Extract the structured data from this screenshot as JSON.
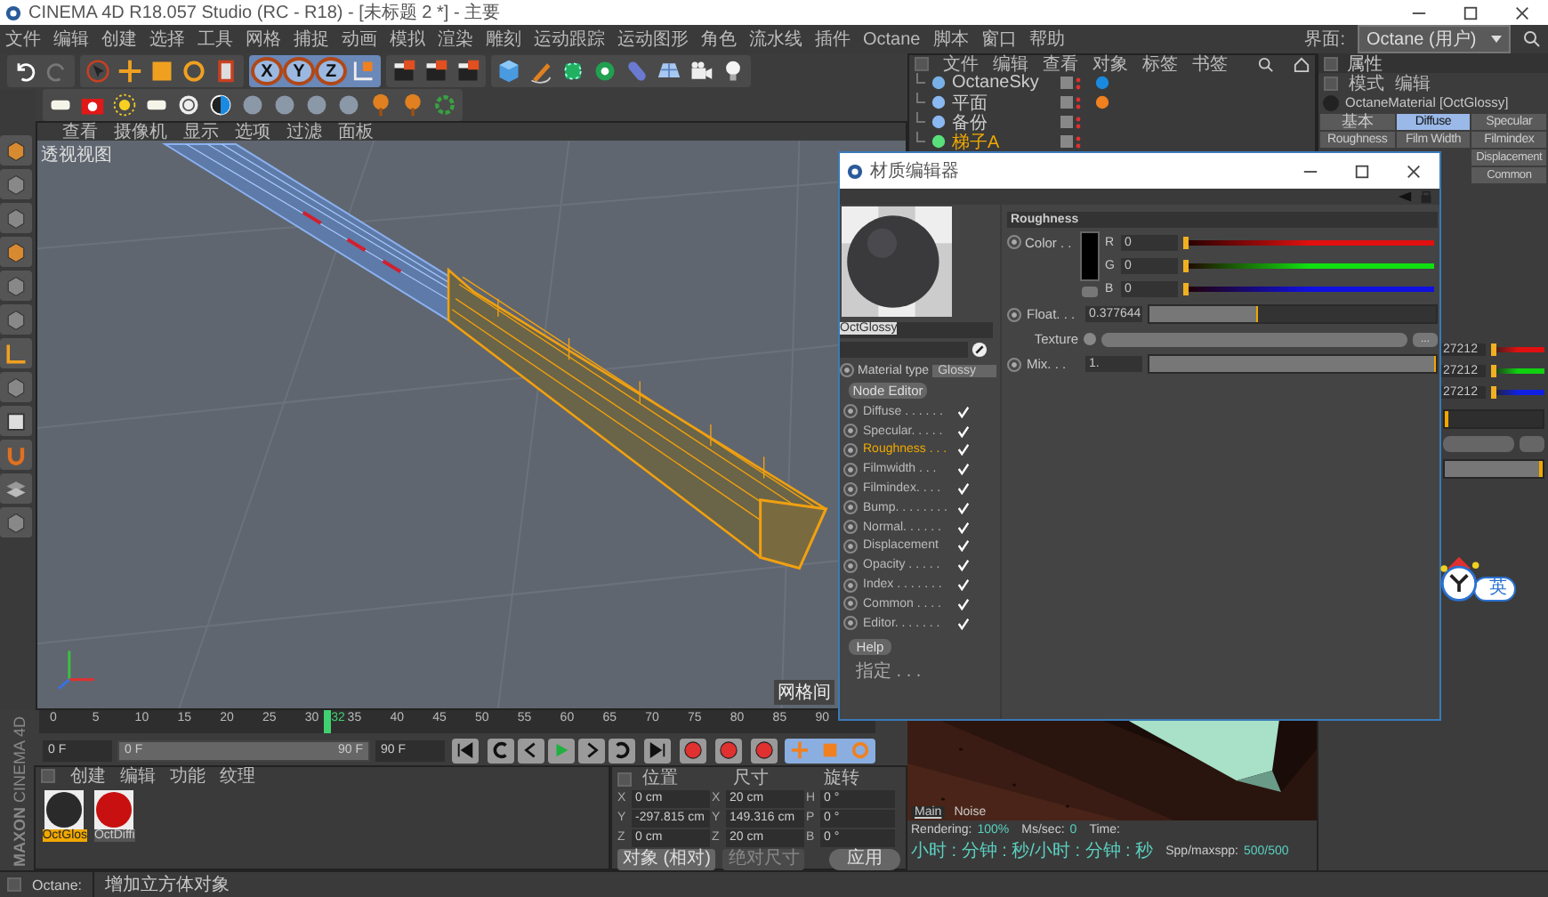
{
  "window": {
    "title": "CINEMA 4D R18.057 Studio (RC - R18) - [未标题 2 *] - 主要"
  },
  "menu": [
    "文件",
    "编辑",
    "创建",
    "选择",
    "工具",
    "网格",
    "捕捉",
    "动画",
    "模拟",
    "渲染",
    "雕刻",
    "运动跟踪",
    "运动图形",
    "角色",
    "流水线",
    "插件",
    "Octane",
    "脚本",
    "窗口",
    "帮助"
  ],
  "layout": {
    "label": "界面:",
    "value": "Octane (用户)"
  },
  "axis_buttons": [
    "X",
    "Y",
    "Z"
  ],
  "viewport": {
    "menu": [
      "查看",
      "摄像机",
      "显示",
      "选项",
      "过滤",
      "面板"
    ],
    "label": "透视视图",
    "grid_label": "网格间"
  },
  "object_manager": {
    "menu": [
      "文件",
      "编辑",
      "查看",
      "对象",
      "标签",
      "书签"
    ],
    "objects": [
      {
        "name": "OctaneSky",
        "selected": false
      },
      {
        "name": "平面",
        "selected": false
      },
      {
        "name": "备份",
        "selected": false
      },
      {
        "name": "梯子A",
        "selected": true
      }
    ]
  },
  "attributes": {
    "title": "属性",
    "menu": [
      "模式",
      "编辑"
    ],
    "material": "OctaneMaterial [OctGlossy]",
    "tabs": [
      {
        "label": "基本",
        "selected": false
      },
      {
        "label": "Diffuse",
        "selected": true
      },
      {
        "label": "Specular",
        "selected": false
      },
      {
        "label": "Roughness",
        "selected": false
      },
      {
        "label": "Film Width",
        "selected": false
      },
      {
        "label": "Filmindex",
        "selected": false
      },
      {
        "label": "Displacement",
        "selected": false
      },
      {
        "label": "Common",
        "selected": false
      }
    ],
    "channels": [
      {
        "value": "27212",
        "level": 0,
        "color": "#e01010"
      },
      {
        "value": "27212",
        "level": 0,
        "color": "#10d010"
      },
      {
        "value": "27212",
        "level": 0,
        "color": "#1020e0"
      }
    ],
    "float": {
      "level": 0
    },
    "mix": {
      "level": 1
    }
  },
  "material_editor": {
    "title": "材质编辑器",
    "name": "OctGlossy",
    "material_type_label": "Material type",
    "material_type": "Glossy",
    "node_editor": "Node Editor",
    "channels": [
      {
        "label": "Diffuse . . . . . .",
        "checked": true,
        "selected": false
      },
      {
        "label": "Specular. . . . .",
        "checked": true,
        "selected": false
      },
      {
        "label": "Roughness . . .",
        "checked": true,
        "selected": true
      },
      {
        "label": "Filmwidth . . .",
        "checked": true,
        "selected": false
      },
      {
        "label": "Filmindex. . . .",
        "checked": true,
        "selected": false
      },
      {
        "label": "Bump. . . . . . . .",
        "checked": true,
        "selected": false
      },
      {
        "label": "Normal. . . . . .",
        "checked": true,
        "selected": false
      },
      {
        "label": "Displacement",
        "checked": true,
        "selected": false
      },
      {
        "label": "Opacity . . . . .",
        "checked": true,
        "selected": false
      },
      {
        "label": "Index . . . . . . .",
        "checked": true,
        "selected": false
      },
      {
        "label": "Common . . . .",
        "checked": true,
        "selected": false
      },
      {
        "label": "Editor. . . . . . .",
        "checked": true,
        "selected": false
      }
    ],
    "help": "Help",
    "assign": "指定 . . .",
    "section": "Roughness",
    "color_label": "Color . .",
    "rgb": [
      {
        "label": "R",
        "value": "0",
        "level": 0,
        "color": "#e01010"
      },
      {
        "label": "G",
        "value": "0",
        "level": 0,
        "color": "#10e010"
      },
      {
        "label": "B",
        "value": "0",
        "level": 0,
        "color": "#1010e0"
      }
    ],
    "float": {
      "label": "Float. . .",
      "value": "0.377644",
      "level": 0.377
    },
    "texture": {
      "label": "Texture",
      "button": "..."
    },
    "mix": {
      "label": "Mix. . .",
      "value": "1.",
      "level": 1
    }
  },
  "timeline": {
    "ticks": [
      "0",
      "5",
      "10",
      "15",
      "20",
      "25",
      "30",
      "35",
      "40",
      "45",
      "50",
      "55",
      "60",
      "65",
      "70",
      "75",
      "80",
      "85",
      "90"
    ],
    "current": "32",
    "playhead": {
      "level": 0.356
    },
    "start": "0 F",
    "range": {
      "start": "0 F",
      "end": "90 F",
      "level": 1
    },
    "end": "90 F"
  },
  "material_manager": {
    "menu": [
      "创建",
      "编辑",
      "功能",
      "纹理"
    ],
    "materials": [
      {
        "name": "OctGlos",
        "selected": true,
        "color": "#2a2a2a"
      },
      {
        "name": "OctDiffi",
        "selected": false,
        "color": "#c81010"
      }
    ]
  },
  "coordinates": {
    "headers": [
      "位置",
      "尺寸",
      "旋转"
    ],
    "rows": [
      [
        {
          "axis": "X",
          "value": "0 cm"
        },
        {
          "axis": "X",
          "value": "20 cm"
        },
        {
          "axis": "H",
          "value": "0 °"
        }
      ],
      [
        {
          "axis": "Y",
          "value": "-297.815 cm"
        },
        {
          "axis": "Y",
          "value": "149.316 cm"
        },
        {
          "axis": "P",
          "value": "0 °"
        }
      ],
      [
        {
          "axis": "Z",
          "value": "0 cm"
        },
        {
          "axis": "Z",
          "value": "20 cm"
        },
        {
          "axis": "B",
          "value": "0 °"
        }
      ]
    ],
    "mode": "对象 (相对)",
    "size_mode": "绝对尺寸",
    "apply": "应用"
  },
  "render_view": {
    "tabs": [
      {
        "label": "Main",
        "selected": true
      },
      {
        "label": "Noise",
        "selected": false
      }
    ],
    "status": [
      {
        "label": "Rendering:",
        "value": "100%"
      },
      {
        "label": "Ms/sec:",
        "value": "0"
      },
      {
        "label": "Time:",
        "value": "小时 : 分钟 : 秒/小时 : 分钟 : 秒"
      },
      {
        "label": "Spp/maxspp:",
        "value": "500/500"
      }
    ]
  },
  "logo": [
    "MAXON",
    "CINEMA 4D"
  ],
  "ime": {
    "label": "英"
  },
  "status_bar": {
    "label": "Octane:",
    "message": "增加立方体对象"
  }
}
